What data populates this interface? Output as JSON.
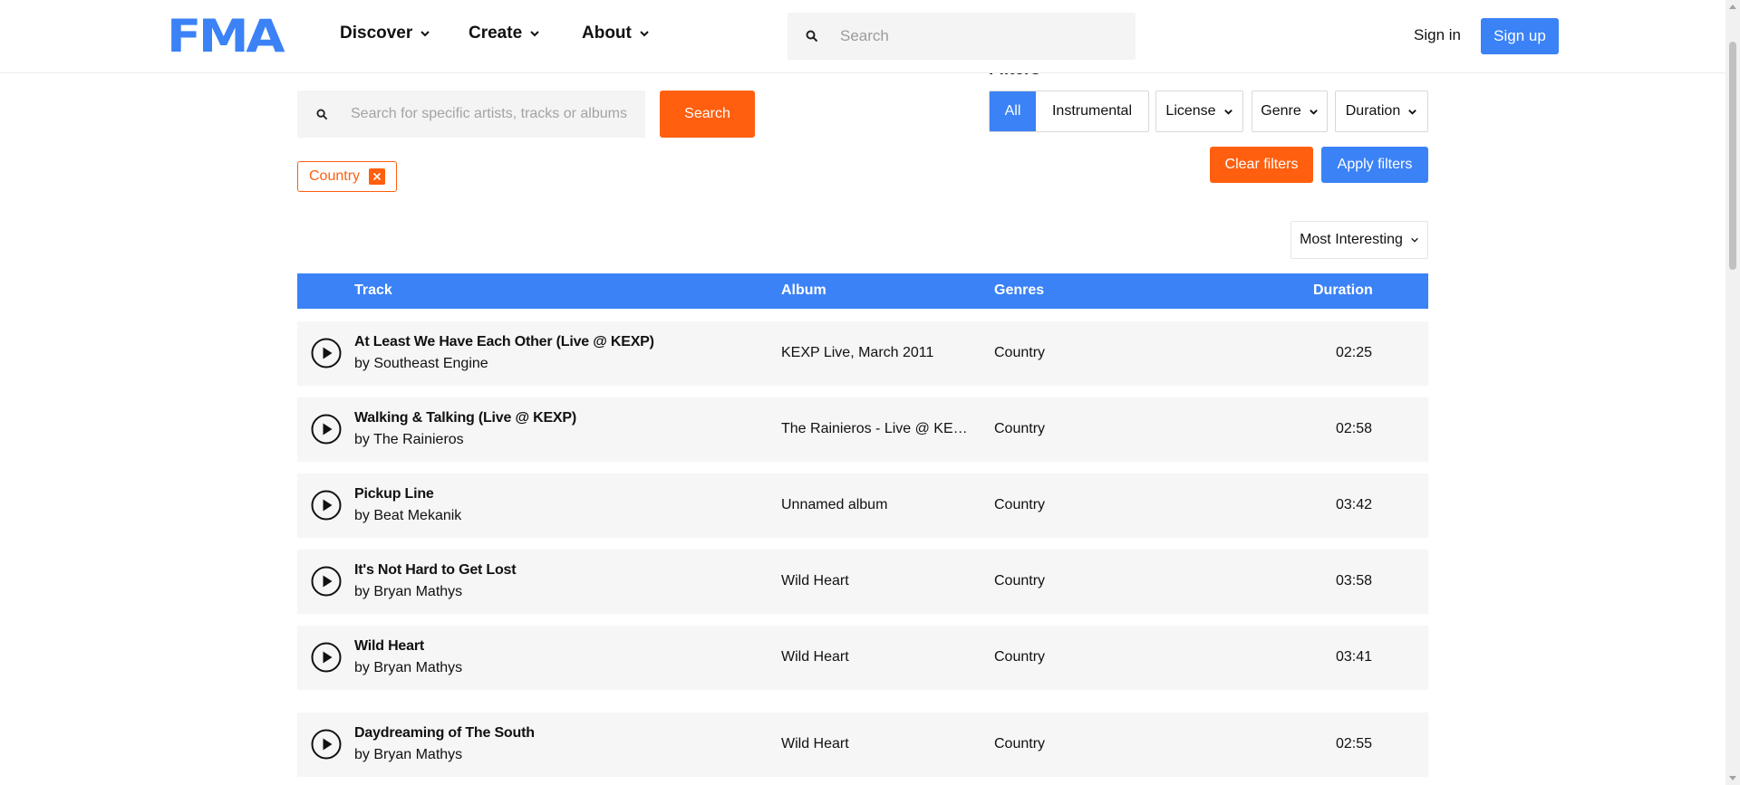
{
  "header": {
    "logo": "FMA",
    "nav": [
      {
        "label": "Discover"
      },
      {
        "label": "Create"
      },
      {
        "label": "About"
      }
    ],
    "search_placeholder": "Search",
    "sign_in": "Sign in",
    "sign_up": "Sign up"
  },
  "filters": {
    "heading": "Filters",
    "search_placeholder": "Search for specific artists, tracks or albums",
    "search_button": "Search",
    "active_chip": "Country",
    "type_options": [
      "All",
      "Instrumental"
    ],
    "type_selected": "All",
    "license": "License",
    "genre": "Genre",
    "duration": "Duration",
    "clear": "Clear filters",
    "apply": "Apply filters",
    "sort": "Most Interesting"
  },
  "table": {
    "columns": {
      "track": "Track",
      "album": "Album",
      "genres": "Genres",
      "duration": "Duration"
    },
    "by_prefix": "by",
    "rows": [
      {
        "title": "At Least We Have Each Other (Live @ KEXP)",
        "artist": "Southeast Engine",
        "album": "KEXP Live, March 2011",
        "genre": "Country",
        "duration": "02:25"
      },
      {
        "title": "Walking & Talking (Live @ KEXP)",
        "artist": "The Rainieros",
        "album": "The Rainieros - Live @ KEXP",
        "genre": "Country",
        "duration": "02:58"
      },
      {
        "title": "Pickup Line",
        "artist": "Beat Mekanik",
        "album": "Unnamed album",
        "genre": "Country",
        "duration": "03:42"
      },
      {
        "title": "It's Not Hard to Get Lost",
        "artist": "Bryan Mathys",
        "album": "Wild Heart",
        "genre": "Country",
        "duration": "03:58"
      },
      {
        "title": "Wild Heart",
        "artist": "Bryan Mathys",
        "album": "Wild Heart",
        "genre": "Country",
        "duration": "03:41"
      },
      {
        "title": "Daydreaming of The South",
        "artist": "Bryan Mathys",
        "album": "Wild Heart",
        "genre": "Country",
        "duration": "02:55"
      }
    ]
  },
  "colors": {
    "brand_blue": "#3b82f6",
    "accent_orange": "#ff5f0f"
  }
}
